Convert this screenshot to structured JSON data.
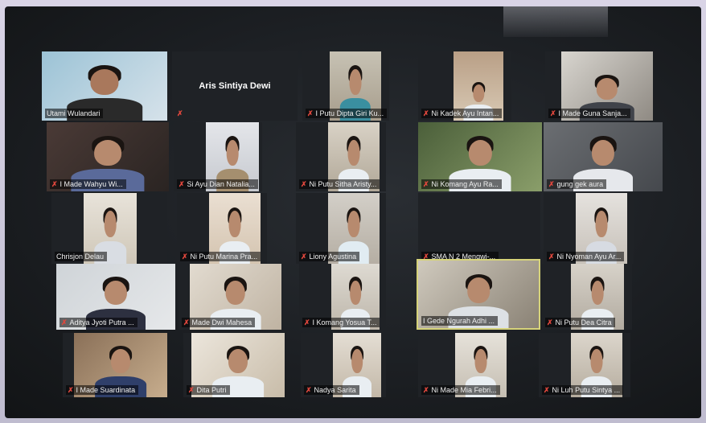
{
  "participants": [
    {
      "name": "Utami Wulandari",
      "muted": false
    },
    {
      "name": "Aris Sintiya Dewi",
      "muted": true
    },
    {
      "name": "I Putu Dipta Giri Ku...",
      "muted": true
    },
    {
      "name": "Ni Kadek Ayu Intan...",
      "muted": true
    },
    {
      "name": "I Made Guna Sanja...",
      "muted": true
    },
    {
      "name": "I Made Wahyu Wi...",
      "muted": true
    },
    {
      "name": "Si Ayu Dian Natalia...",
      "muted": true
    },
    {
      "name": "Ni Putu Sitha Aristy...",
      "muted": true
    },
    {
      "name": "Ni Komang Ayu Ra...",
      "muted": true
    },
    {
      "name": "gung gek aura",
      "muted": true
    },
    {
      "name": "Chrisjon Delau",
      "muted": false
    },
    {
      "name": "Ni Putu Marina Pra...",
      "muted": true
    },
    {
      "name": "Liony Agustina",
      "muted": true
    },
    {
      "name": "SMA N 2 Mengwi-...",
      "muted": true
    },
    {
      "name": "Ni Nyoman Ayu Ar...",
      "muted": true
    },
    {
      "name": "Aditya Jyoti Putra ...",
      "muted": true
    },
    {
      "name": "Made Dwi Mahesa",
      "muted": true
    },
    {
      "name": "I Komang Yosua T...",
      "muted": true
    },
    {
      "name": "I Gede Ngurah Adhi ...",
      "muted": false
    },
    {
      "name": "Ni Putu Dea Citra",
      "muted": true
    },
    {
      "name": "I Made Suardinata",
      "muted": true
    },
    {
      "name": "Dita Putri",
      "muted": true
    },
    {
      "name": "Nadya Sarita",
      "muted": true
    },
    {
      "name": "Ni Made Mia Febri...",
      "muted": true
    },
    {
      "name": "Ni Luh Putu Sintya ...",
      "muted": true
    }
  ],
  "icons": {
    "mute": "muted-mic-icon"
  },
  "colors": {
    "active_speaker_border": "#d6d37a",
    "mute_icon": "#e0473d"
  }
}
